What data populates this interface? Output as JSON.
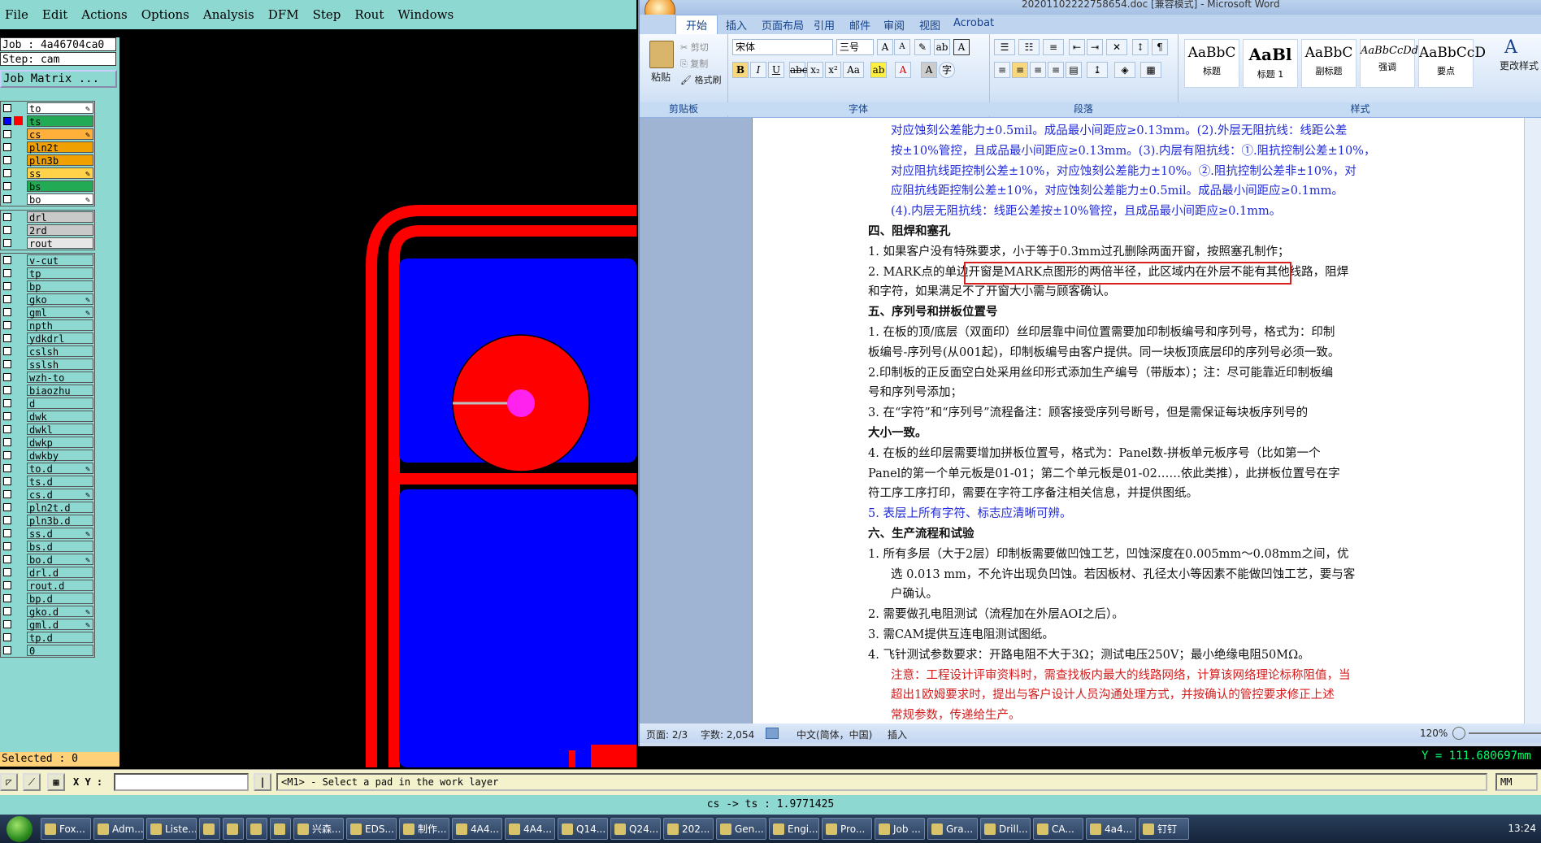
{
  "genesis": {
    "menu": [
      "File",
      "Edit",
      "Actions",
      "Options",
      "Analysis",
      "DFM",
      "Step",
      "Rout",
      "Windows"
    ],
    "job_label": "Job : 4a46704ca0",
    "step_label": "Step: cam",
    "matrix_button": "Job Matrix ...",
    "layers": [
      {
        "name": "to",
        "color": "#ffffff",
        "active": false,
        "edit": true
      },
      {
        "name": "ts",
        "color": "#22aa55",
        "active": true,
        "edit": false
      },
      {
        "name": "cs",
        "color": "#ffb03a",
        "active": false,
        "edit": true
      },
      {
        "name": "pln2t",
        "color": "#f0a000",
        "active": false,
        "edit": false
      },
      {
        "name": "pln3b",
        "color": "#f0a000",
        "active": false,
        "edit": false
      },
      {
        "name": "ss",
        "color": "#ffd24a",
        "active": false,
        "edit": true
      },
      {
        "name": "bs",
        "color": "#22aa55",
        "active": false,
        "edit": false
      },
      {
        "name": "bo",
        "color": "#ffffff",
        "active": false,
        "edit": true
      }
    ],
    "drill_layers": [
      {
        "name": "drl",
        "color": "#c9c9c9"
      },
      {
        "name": "2rd",
        "color": "#c9c9c9"
      },
      {
        "name": "rout",
        "color": "#e6e6e6"
      }
    ],
    "misc_layers": [
      "v-cut",
      "tp",
      "bp",
      "gko",
      "gml",
      "npth",
      "ydkdrl",
      "cslsh",
      "sslsh",
      "wzh-to",
      "biaozhu",
      "d",
      "dwk",
      "dwkl",
      "dwkp",
      "dwkby",
      "to.d",
      "ts.d",
      "cs.d",
      "pln2t.d",
      "pln3b.d",
      "ss.d",
      "bs.d",
      "bo.d",
      "drl.d",
      "rout.d",
      "bp.d",
      "gko.d",
      "gml.d",
      "tp.d",
      "0"
    ],
    "misc_edit_marks": [
      "gko",
      "gml",
      "to.d",
      "cs.d",
      "ss.d",
      "bo.d",
      "gko.d",
      "gml.d"
    ],
    "selected_label": "Selected : 0",
    "xy_label": "X Y :",
    "prompt": "<M1> - Select a pad in the work layer",
    "units": "MM",
    "status_center": "cs -> ts : 1.9771425",
    "y_coord": "Y = 111.680697mm"
  },
  "word": {
    "title": "20201102222758654.doc [兼容模式] - Microsoft Word",
    "tabs": [
      "开始",
      "插入",
      "页面布局",
      "引用",
      "邮件",
      "审阅",
      "视图",
      "Acrobat"
    ],
    "clipboard": {
      "paste": "粘贴",
      "cut": "剪切",
      "copy": "复制",
      "format_painter": "格式刷",
      "label": "剪贴板"
    },
    "font": {
      "name": "宋体",
      "size": "三号",
      "label": "字体"
    },
    "paragraph_label": "段落",
    "styles_label": "样式",
    "styles": [
      {
        "preview": "AaBbC",
        "name": "标题"
      },
      {
        "preview": "AaBl",
        "name": "标题 1"
      },
      {
        "preview": "AaBbC",
        "name": "副标题"
      },
      {
        "preview": "AaBbCcDd",
        "name": "强调"
      },
      {
        "preview": "AaBbCcD",
        "name": "要点"
      }
    ],
    "change_styles": "更改样式",
    "doc_lines": [
      {
        "text": "对应蚀刻公差能力±0.5mil。成品最小间距应≥0.13mm。(2).外层无阻抗线：线距公差",
        "cls": "blue ind"
      },
      {
        "text": "按±10%管控，且成品最小间距应≥0.13mm。(3).内层有阻抗线：①.阻抗控制公差±10%，",
        "cls": "blue ind"
      },
      {
        "text": "对应阻抗线距控制公差±10%，对应蚀刻公差能力±10%。②.阻抗控制公差非±10%，对",
        "cls": "blue ind"
      },
      {
        "text": "应阻抗线距控制公差±10%，对应蚀刻公差能力±0.5mil。成品最小间距应≥0.1mm。",
        "cls": "blue ind"
      },
      {
        "text": "(4).内层无阻抗线：线距公差按±10%管控，且成品最小间距应≥0.1mm。",
        "cls": "blue ind"
      },
      {
        "text": "四、阻焊和塞孔",
        "cls": "bold"
      },
      {
        "text": "1. 如果客户没有特殊要求，小于等于0.3mm过孔删除两面开窗，按照塞孔制作；",
        "cls": ""
      },
      {
        "text": "2. MARK点的单边开窗是MARK点图形的两倍半径，此区域内在外层不能有其他线路，阻焊",
        "cls": ""
      },
      {
        "text": "和字符，如果满足不了开窗大小需与顾客确认。",
        "cls": ""
      },
      {
        "text": "五、序列号和拼板位置号",
        "cls": "bold"
      },
      {
        "text": "1. 在板的顶/底层（双面印）丝印层靠中间位置需要加印制板编号和序列号，格式为：印制",
        "cls": ""
      },
      {
        "text": "板编号-序列号(从001起)，印制板编号由客户提供。同一块板顶底层印的序列号必须一致。",
        "cls": ""
      },
      {
        "text": "2.印制板的正反面空白处采用丝印形式添加生产编号（带版本）；注：尽可能靠近印制板编",
        "cls": ""
      },
      {
        "text": "号和序列号添加；",
        "cls": ""
      },
      {
        "text": "3. 在“字符”和“序列号”流程备注：顾客接受序列号断号，但是需保证每块板序列号的",
        "cls": ""
      },
      {
        "text": "大小一致。",
        "cls": "bold"
      },
      {
        "text": "4. 在板的丝印层需要增加拼板位置号，格式为：Panel数-拼板单元板序号（比如第一个",
        "cls": ""
      },
      {
        "text": "Panel的第一个单元板是01-01；第二个单元板是01-02……依此类推），此拼板位置号在字",
        "cls": ""
      },
      {
        "text": "符工序工序打印，需要在字符工序备注相关信息，并提供图纸。",
        "cls": ""
      },
      {
        "text": "5. 表层上所有字符、标志应清晰可辨。",
        "cls": "blue"
      },
      {
        "text": "六、生产流程和试验",
        "cls": "bold"
      },
      {
        "text": "1.   所有多层（大于2层）印制板需要做凹蚀工艺，凹蚀深度在0.005mm～0.08mm之间，优",
        "cls": ""
      },
      {
        "text": "选 0.013 mm，不允许出现负凹蚀。若因板材、孔径太小等因素不能做凹蚀工艺，要与客",
        "cls": "ind"
      },
      {
        "text": "户确认。",
        "cls": "ind"
      },
      {
        "text": "2.   需要做孔电阻测试（流程加在外层AOI之后）。",
        "cls": ""
      },
      {
        "text": "3.   需CAM提供互连电阻测试图纸。",
        "cls": ""
      },
      {
        "text": "4.   飞针测试参数要求：开路电阻不大于3Ω；测试电压250V；最小绝缘电阻50MΩ。",
        "cls": ""
      },
      {
        "text": "注意：工程设计评审资料时，需查找板内最大的线路网络，计算该网络理论标称阻值，当",
        "cls": "red ind"
      },
      {
        "text": "超出1欧姆要求时，提出与客户设计人员沟通处理方式，并按确认的管控要求修正上述",
        "cls": "red ind"
      },
      {
        "text": "常规参数，传递给生产。",
        "cls": "red ind"
      }
    ],
    "status": {
      "page": "页面: 2/3",
      "words": "字数: 2,054",
      "lang": "中文(简体，中国)",
      "mode": "插入",
      "zoom": "120%"
    }
  },
  "taskbar": {
    "items": [
      "Fox...",
      "Adm...",
      "Liste...",
      "",
      "",
      "",
      "",
      "兴森...",
      "EDS...",
      "制作...",
      "4A4...",
      "4A4...",
      "Q14...",
      "Q24...",
      "202...",
      "Gen...",
      "Engi...",
      "Pro...",
      "Job ...",
      "Gra...",
      "Drill...",
      "CA...",
      "4a4...",
      "钉钉"
    ],
    "clock": "13:24"
  }
}
